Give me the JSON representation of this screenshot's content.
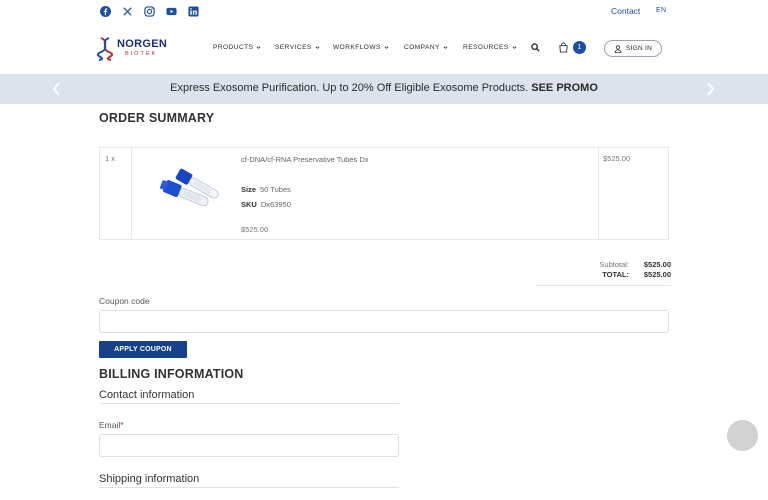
{
  "topbar": {
    "social_icons": [
      "facebook-icon",
      "x-icon",
      "instagram-icon",
      "youtube-icon",
      "linkedin-icon"
    ],
    "contact_label": "Contact",
    "language": "EN"
  },
  "brand": {
    "name": "NORGEN",
    "subtitle": "BIOTEK"
  },
  "nav": {
    "items": [
      {
        "label": "PRODUCTS"
      },
      {
        "label": "SERVICES"
      },
      {
        "label": "WORKFLOWS"
      },
      {
        "label": "COMPANY"
      },
      {
        "label": "RESOURCES"
      }
    ],
    "cart_count": "1",
    "sign_in": "SIGN IN"
  },
  "promo": {
    "text": "Express Exosome Purification. Up to 20% Off Eligible Exosome Products.",
    "link": "SEE PROMO"
  },
  "order_summary": {
    "title": "ORDER SUMMARY",
    "items": [
      {
        "qty": "1 x",
        "name": "cf-DNA/cf-RNA Preservative Tubes Dx",
        "size_label": "Size",
        "size_value": "50 Tubes",
        "sku_label": "SKU",
        "sku_value": "Dx63950",
        "price": "$525.00",
        "line_total": "$525.00"
      }
    ],
    "subtotal_label": "Subtotal:",
    "subtotal_value": "$525.00",
    "total_label": "TOTAL:",
    "total_value": "$525.00"
  },
  "coupon": {
    "label": "Coupon code",
    "value": "",
    "button": "APPLY COUPON"
  },
  "billing": {
    "title": "BILLING INFORMATION",
    "contact_heading": "Contact information",
    "email_label": "Email",
    "email_required": "*",
    "email_value": "",
    "shipping_heading": "Shipping information"
  },
  "colors": {
    "brand_blue": "#1c4fa1",
    "button_blue": "#15418c",
    "promo_bg": "#dde3ec",
    "required_red": "#c4262e"
  }
}
